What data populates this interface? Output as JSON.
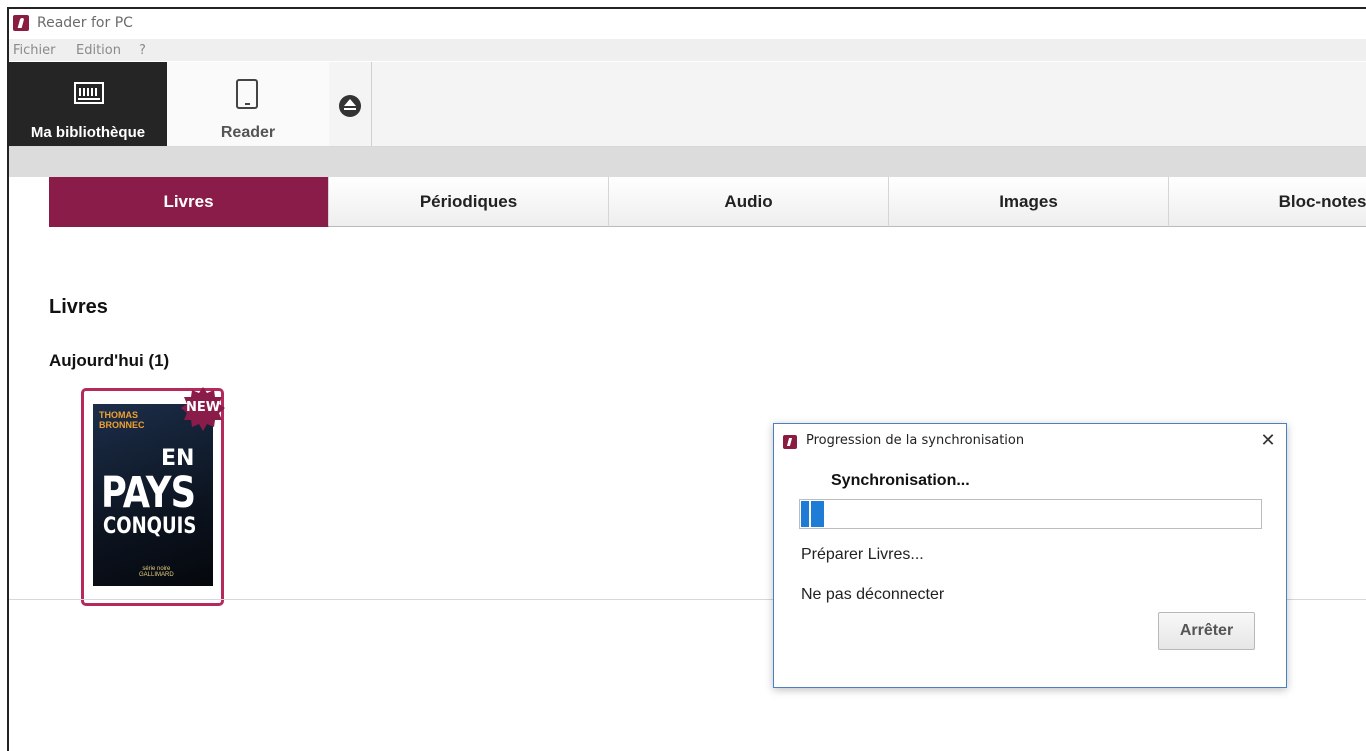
{
  "window": {
    "title": "Reader for PC"
  },
  "menu": [
    "Fichier",
    "Edition",
    "?"
  ],
  "toolbar": {
    "library_label": "Ma bibliothèque",
    "reader_label": "Reader"
  },
  "tabs": [
    {
      "label": "Livres",
      "active": true
    },
    {
      "label": "Périodiques",
      "active": false
    },
    {
      "label": "Audio",
      "active": false
    },
    {
      "label": "Images",
      "active": false
    },
    {
      "label": "Bloc-notes",
      "active": false
    }
  ],
  "content": {
    "section_title": "Livres",
    "group_title": "Aujourd'hui (1)",
    "book": {
      "badge": "NEW",
      "cover_author": "THOMAS\nBRONNEC",
      "cover_title_1": "EN",
      "cover_title_2": "PAYS",
      "cover_title_3": "CONQUIS",
      "cover_publisher": "série noire\nGALLIMARD"
    }
  },
  "dialog": {
    "title": "Progression de la synchronisation",
    "heading": "Synchronisation...",
    "progress": 0.05,
    "status_1": "Préparer Livres...",
    "status_2": "Ne pas déconnecter",
    "stop_label": "Arrêter"
  },
  "colors": {
    "accent": "#8a1c4a",
    "progress": "#1f7cd6",
    "dialog_border": "#4a7fc1"
  },
  "icons": {
    "app_logo": "reader-logo-icon",
    "library": "bookshelf-icon",
    "reader": "tablet-icon",
    "eject": "eject-icon",
    "close": "close-icon"
  }
}
